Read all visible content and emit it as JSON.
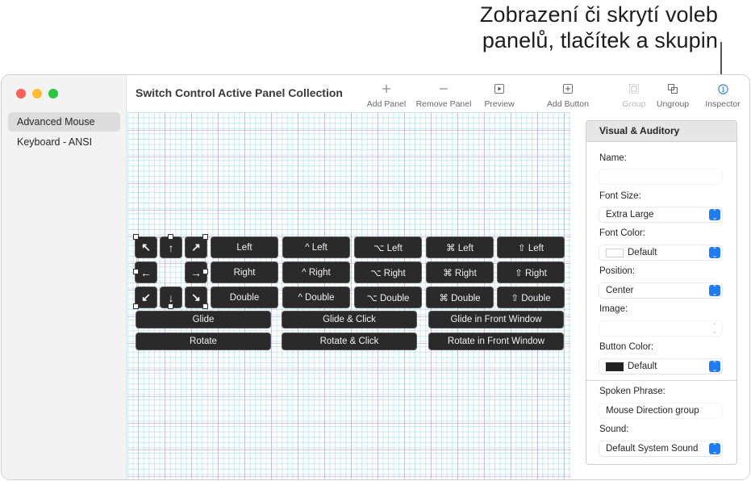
{
  "callout": {
    "line1": "Zobrazení či skrytí voleb",
    "line2": "panelů, tlačítek a skupin"
  },
  "window": {
    "title": "Switch Control Active Panel Collection"
  },
  "sidebar": {
    "items": [
      {
        "label": "Advanced Mouse",
        "selected": true
      },
      {
        "label": "Keyboard - ANSI",
        "selected": false
      }
    ]
  },
  "toolbar": {
    "buttons": [
      {
        "label": "Add Panel",
        "icon": "plus-icon",
        "enabled": true
      },
      {
        "label": "Remove Panel",
        "icon": "minus-icon",
        "enabled": true
      },
      {
        "label": "Preview",
        "icon": "play-icon",
        "enabled": true
      },
      {
        "label": "Add Button",
        "icon": "add-button-icon",
        "enabled": true
      },
      {
        "label": "Group",
        "icon": "group-icon",
        "enabled": false
      },
      {
        "label": "Ungroup",
        "icon": "ungroup-icon",
        "enabled": true
      },
      {
        "label": "Inspector",
        "icon": "info-icon",
        "enabled": true,
        "accent": "#1e7cf7"
      }
    ]
  },
  "canvas": {
    "arrows": {
      "up_left": "↖",
      "up": "↑",
      "up_right": "↗",
      "left": "←",
      "right": "→",
      "down_left": "↙",
      "down": "↓",
      "down_right": "↘"
    },
    "rows": [
      [
        "Left",
        "^ Left",
        "⌥ Left",
        "⌘ Left",
        "⇧ Left"
      ],
      [
        "Right",
        "^ Right",
        "⌥ Right",
        "⌘ Right",
        "⇧ Right"
      ],
      [
        "Double",
        "^ Double",
        "⌥ Double",
        "⌘ Double",
        "⇧ Double"
      ]
    ],
    "wide_rows": [
      [
        "Glide",
        "Glide & Click",
        "Glide in Front Window"
      ],
      [
        "Rotate",
        "Rotate & Click",
        "Rotate in Front Window"
      ]
    ]
  },
  "inspector": {
    "section_title": "Visual & Auditory",
    "name_label": "Name:",
    "name_value": "",
    "font_size_label": "Font Size:",
    "font_size_value": "Extra Large",
    "font_color_label": "Font Color:",
    "font_color_value": "Default",
    "position_label": "Position:",
    "position_value": "Center",
    "image_label": "Image:",
    "image_value": "",
    "button_color_label": "Button Color:",
    "button_color_value": "Default",
    "spoken_phrase_label": "Spoken Phrase:",
    "spoken_phrase_value": "Mouse Direction group",
    "sound_label": "Sound:",
    "sound_value": "Default System Sound"
  }
}
